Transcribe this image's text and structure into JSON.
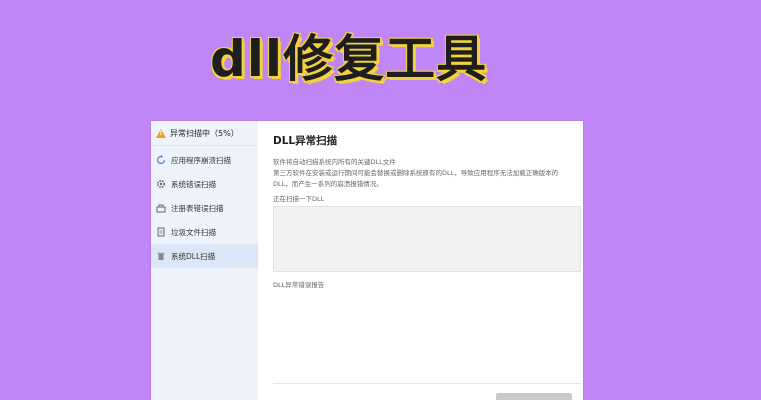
{
  "hero": {
    "title": "dll修复工具"
  },
  "sidebar": {
    "status": "异常扫描中（5%）",
    "items": [
      {
        "label": "应用程序崩溃扫描",
        "icon": "refresh-icon"
      },
      {
        "label": "系统错误扫描",
        "icon": "gear-icon"
      },
      {
        "label": "注册表错误扫描",
        "icon": "registry-icon"
      },
      {
        "label": "垃圾文件扫描",
        "icon": "file-icon"
      },
      {
        "label": "系统DLL扫描",
        "icon": "trash-icon",
        "active": true
      }
    ]
  },
  "main": {
    "title": "DLL异常扫描",
    "desc_line1": "软件将自动扫描系统内所有的关键DLL文件",
    "desc_line2": "第三方软件在安装或运行期间可能会替换或删除系统原有的DLL，导致应用程序无法加载正确版本的",
    "desc_line3": "DLL，而产生一系列的崩溃报错情况。",
    "scan_label": "正在扫描一下DLL",
    "report_label": "DLL异常错误报告"
  },
  "colors": {
    "background": "#c086f6",
    "sidebar": "#eef3fb",
    "active": "#dbe6f6",
    "accent_yellow": "#f3d23a",
    "warn": "#f0a020"
  }
}
